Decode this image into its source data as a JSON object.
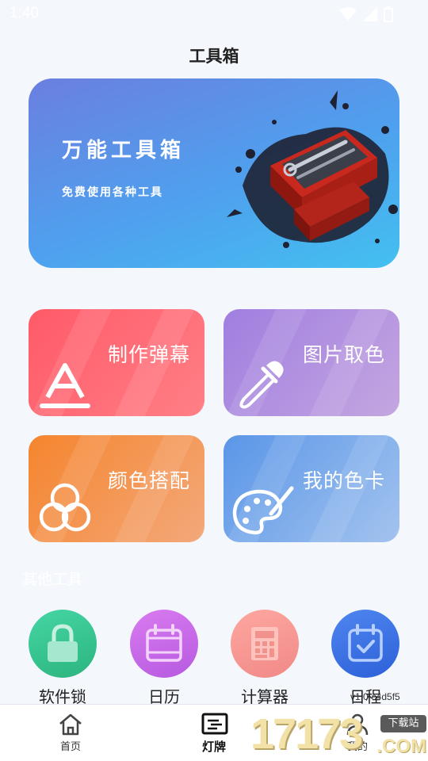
{
  "status_bar": {
    "time": "1:40",
    "icons": [
      "wifi-icon",
      "signal-icon",
      "battery-icon"
    ]
  },
  "header": {
    "title": "工具箱"
  },
  "banner": {
    "title": "万能工具箱",
    "subtitle": "免费使用各种工具",
    "image": "toolbox-illustration"
  },
  "tools": [
    {
      "label": "制作弹幕",
      "icon": "letter-a-icon",
      "color": "#ff5a68"
    },
    {
      "label": "图片取色",
      "icon": "eyedropper-icon",
      "color": "#a07ee0"
    },
    {
      "label": "颜色搭配",
      "icon": "color-circles-icon",
      "color": "#f5852e"
    },
    {
      "label": "我的色卡",
      "icon": "palette-icon",
      "color": "#5a96e8"
    }
  ],
  "other_tools": {
    "title": "其他工具",
    "items": [
      {
        "label": "软件锁",
        "icon": "lock-icon",
        "color": "#2cb47e"
      },
      {
        "label": "日历",
        "icon": "calendar-icon",
        "color": "#b65ae0"
      },
      {
        "label": "计算器",
        "icon": "calculator-icon",
        "color": "#f08987"
      },
      {
        "label": "日程",
        "icon": "schedule-icon",
        "color": "#2d60d8"
      }
    ]
  },
  "version": "v1.0-c4d5f5",
  "bottom_nav": {
    "items": [
      {
        "label": "首页",
        "icon": "home-icon",
        "active": false
      },
      {
        "label": "灯牌",
        "icon": "sign-icon",
        "active": true
      },
      {
        "label": "我的",
        "icon": "person-icon",
        "active": false
      }
    ]
  },
  "watermark": {
    "digits": "17173",
    "tag": "下载站",
    "suffix": ".COM"
  }
}
